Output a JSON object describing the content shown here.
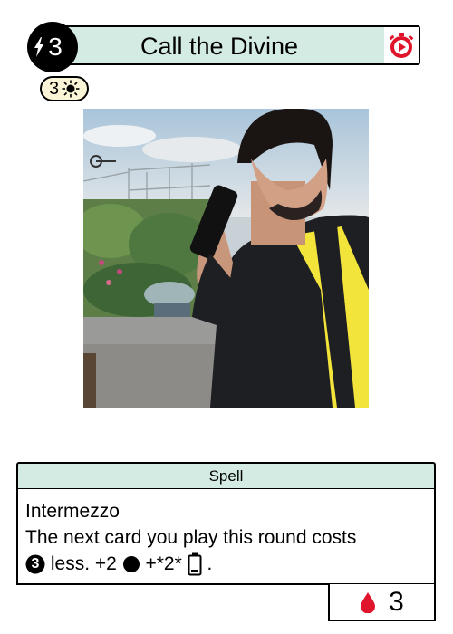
{
  "card": {
    "name": "Call the Divine",
    "cost": "3",
    "sub_cost": "3",
    "type": "Spell",
    "keyword": "Intermezzo",
    "rules_line1": "The next card you play this round costs",
    "rules_line2": {
      "amount": "3",
      "text_a": "less. +2",
      "text_b": "+*2*",
      "text_c": "."
    },
    "stat": "3"
  },
  "icons": {
    "title_right": "timer-icon",
    "cost": "lightning-bolt-icon",
    "pill": "sun-icon",
    "stat": "blood-drop-icon",
    "rules_a": "number-three-circle-icon",
    "rules_b": "black-circle-icon",
    "rules_c": "battery-icon"
  },
  "colors": {
    "header_bg": "#d3ebe2",
    "pill_bg": "#fbf5d8",
    "accent_red": "#e0142a"
  }
}
